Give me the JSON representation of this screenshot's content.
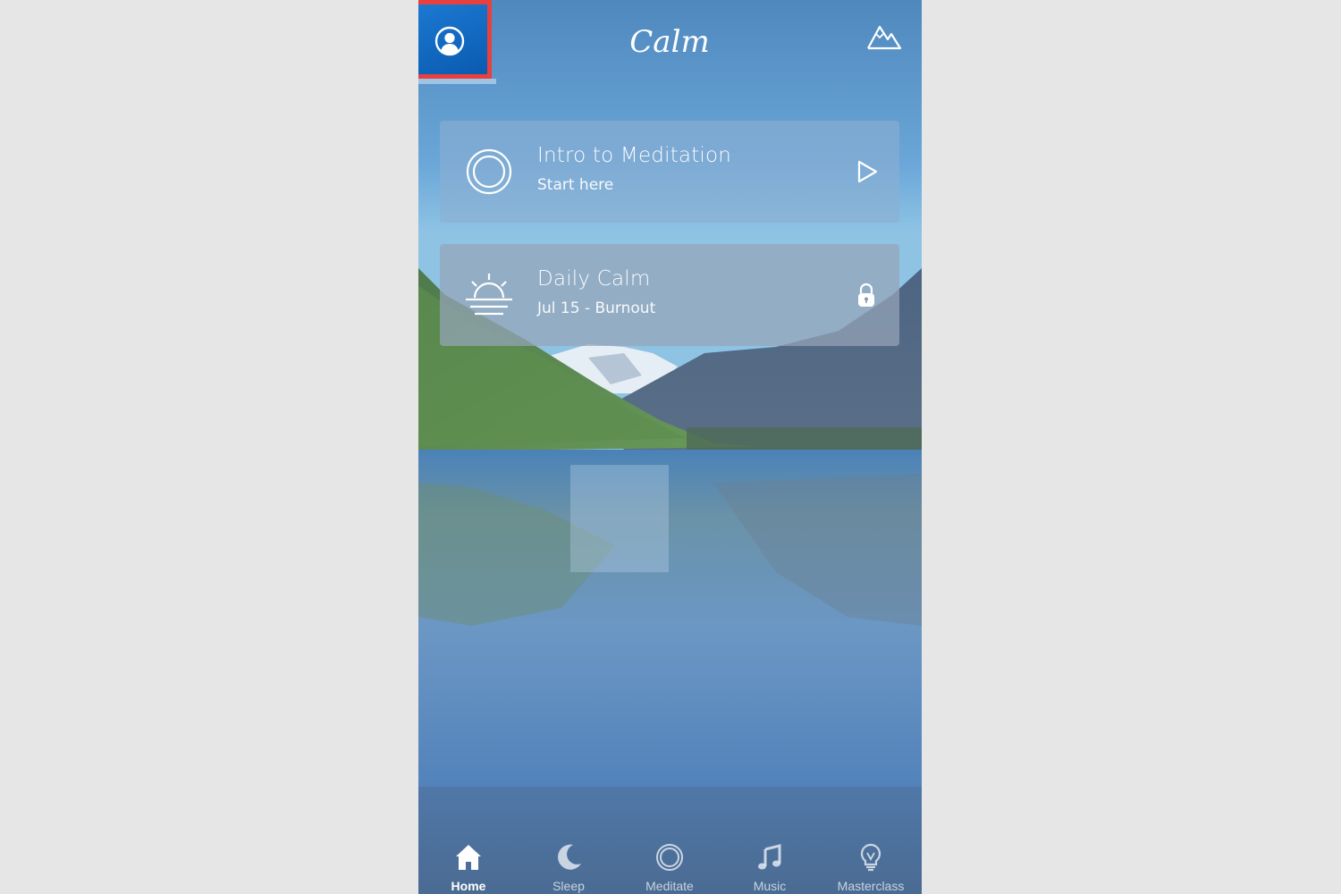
{
  "app": {
    "logo_text": "Calm"
  },
  "header": {
    "profile_icon": "profile-icon",
    "scenes_icon": "mountain-icon"
  },
  "cards": [
    {
      "title": "Intro to Meditation",
      "subtitle": "Start here",
      "icon": "circle-icon",
      "action_icon": "play-icon"
    },
    {
      "title": "Daily Calm",
      "subtitle": "Jul 15 - Burnout",
      "icon": "sunrise-icon",
      "action_icon": "lock-icon"
    }
  ],
  "tabs": [
    {
      "label": "Home",
      "icon": "home-icon",
      "active": true
    },
    {
      "label": "Sleep",
      "icon": "moon-icon",
      "active": false
    },
    {
      "label": "Meditate",
      "icon": "circle-icon",
      "active": false
    },
    {
      "label": "Music",
      "icon": "music-note-icon",
      "active": false
    },
    {
      "label": "Masterclass",
      "icon": "lightbulb-icon",
      "active": false
    }
  ],
  "colors": {
    "highlight_border": "#e8403f",
    "profile_button": "#0a5bb0"
  }
}
